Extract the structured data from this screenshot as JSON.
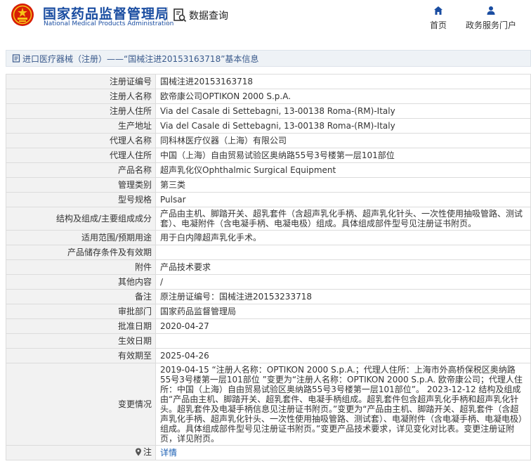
{
  "header": {
    "logo_cn": "国家药品监督管理局",
    "logo_en": "National Medical Products Administration",
    "query_label": "数据查询",
    "nav": [
      {
        "label": "首页",
        "icon": "home-icon"
      },
      {
        "label": "政务服务门户",
        "icon": "user-icon"
      }
    ]
  },
  "breadcrumb": {
    "text": "进口医疗器械（注册）——“国械注进20153163718”基本信息"
  },
  "colors": {
    "brand": "#1a4da1",
    "link": "#1a5fb4",
    "label_bg": "#f2f2f2",
    "border": "#dcdcdc"
  },
  "details": [
    {
      "label": "注册证编号",
      "value": "国械注进20153163718"
    },
    {
      "label": "注册人名称",
      "value": "欧帝康公司OPTIKON 2000 S.p.A."
    },
    {
      "label": "注册人住所",
      "value": "Via del Casale di Settebagni, 13-00138 Roma-(RM)-Italy"
    },
    {
      "label": "生产地址",
      "value": "Via del Casale di Settebagni, 13-00138 Roma-(RM)-Italy"
    },
    {
      "label": "代理人名称",
      "value": "同科林医疗仪器（上海）有限公司"
    },
    {
      "label": "代理人住所",
      "value": "中国（上海）自由贸易试验区奥纳路55号3号楼第一层101部位"
    },
    {
      "label": "产品名称",
      "value": "超声乳化仪Ophthalmic Surgical Equipment"
    },
    {
      "label": "管理类别",
      "value": "第三类"
    },
    {
      "label": "型号规格",
      "value": "Pulsar"
    },
    {
      "label": "结构及组成/主要组成成分",
      "value": "产品由主机、脚踏开关、超乳套件（含超声乳化手柄、超声乳化针头、一次性使用抽吸管路、测试套）、电凝附件（含电凝手柄、电凝电极）组成。具体组成部件型号见注册证书附页。"
    },
    {
      "label": "适用范围/预期用途",
      "value": "用于白内障超声乳化手术。"
    },
    {
      "label": "产品储存条件及有效期",
      "value": ""
    },
    {
      "label": "附件",
      "value": "产品技术要求"
    },
    {
      "label": "其他内容",
      "value": "/"
    },
    {
      "label": "备注",
      "value": "原注册证编号：国械注进20153233718"
    },
    {
      "label": "审批部门",
      "value": "国家药品监督管理局"
    },
    {
      "label": "批准日期",
      "value": "2020-04-27"
    },
    {
      "label": "生效日期",
      "value": ""
    },
    {
      "label": "有效期至",
      "value": "2025-04-26"
    },
    {
      "label": "变更情况",
      "value": "2019-04-15 “注册人名称：OPTIKON 2000 S.p.A.；代理人住所：上海市外高桥保税区奥纳路55号3号楼第一层101部位 ”变更为“注册人名称：OPTIKON 2000 S.p.A. 欧帝康公司；代理人住所：中国（上海）自由贸易试验区奥纳路55号3号楼第一层101部位”。 2023-12-12 结构及组成由“产品由主机、脚踏开关、超乳套件、电凝手柄组成。超乳套件包含超声乳化手柄和超声乳化针头。超乳套件及电凝手柄信息见注册证书附页。”变更为“产品由主机、脚踏开关、超乳套件（含超声乳化手柄、超声乳化针头、一次性使用抽吸管路、测试套）、电凝附件（含电凝手柄、电凝电极）组成。具体组成部件型号见注册证书附页。”变更产品技术要求，详见变化对比表。变更注册证附页，详见附页。"
    }
  ],
  "note": {
    "label": "注",
    "link": "详情"
  }
}
